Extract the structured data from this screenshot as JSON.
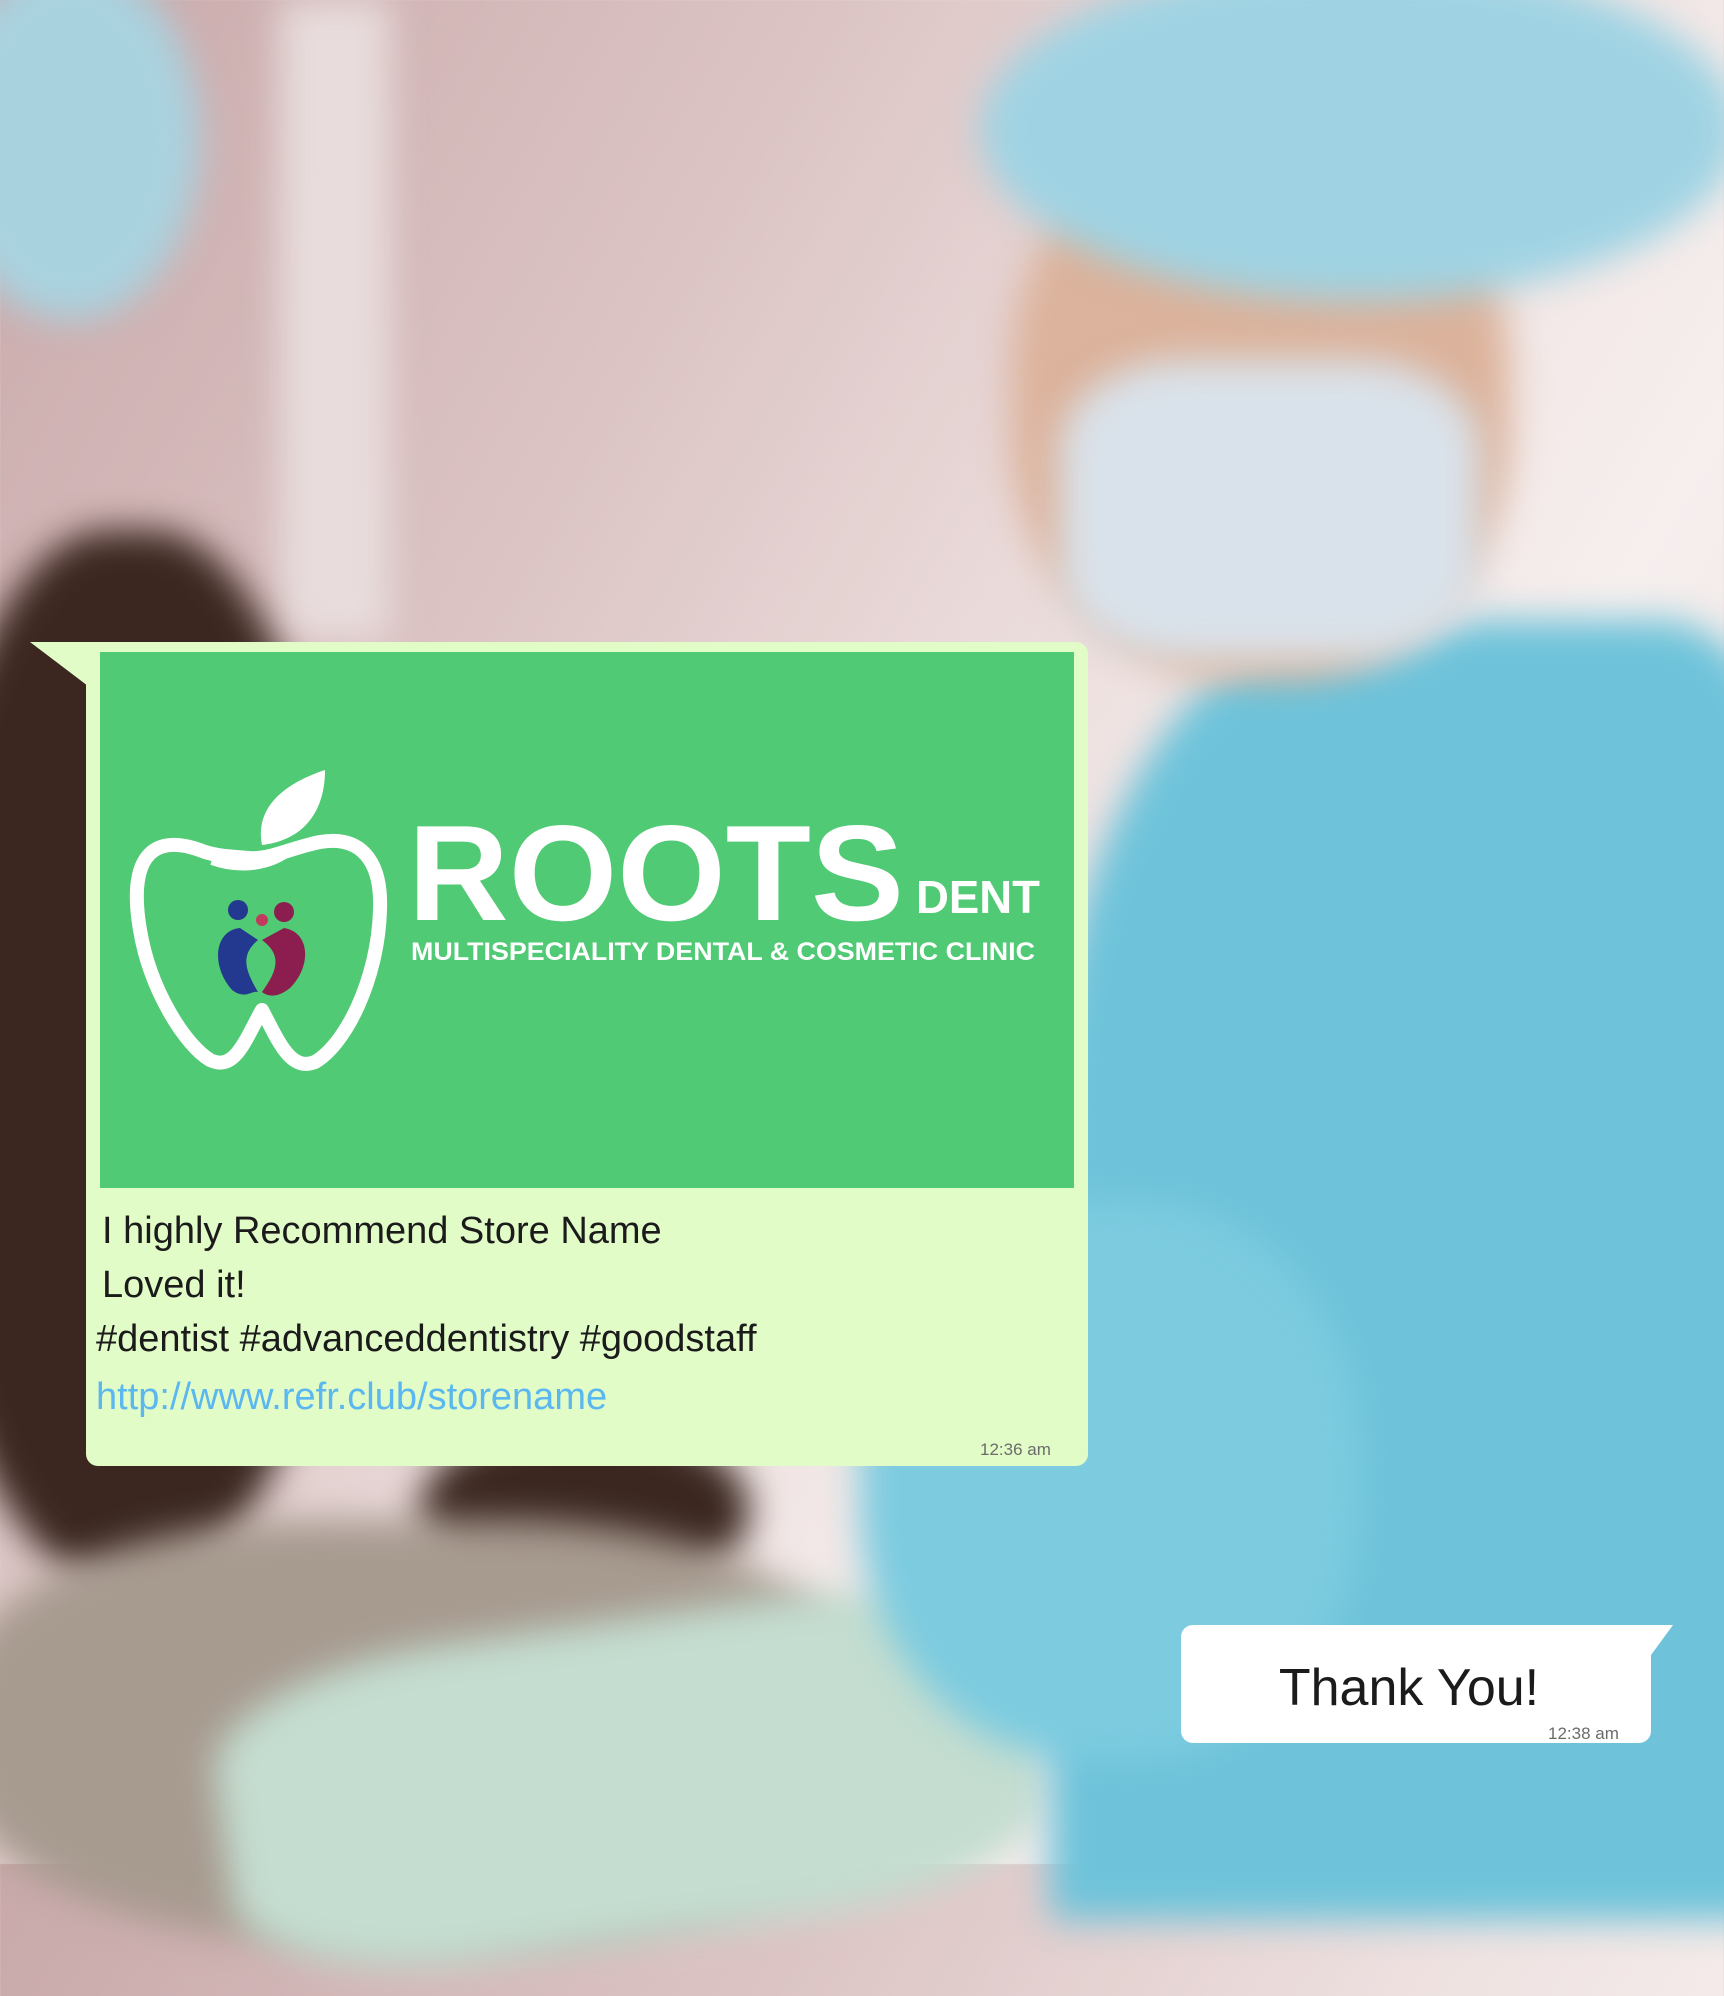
{
  "logo": {
    "brand": "ROOTS",
    "suffix": "DENT",
    "tagline": "MULTISPECIALITY DENTAL & COSMETIC CLINIC"
  },
  "incoming_message": {
    "lines": [
      "I highly Recommend Store Name",
      "Loved it!",
      "#dentist #advanceddentistry #goodstaff"
    ],
    "link": "http://www.refr.club/storename",
    "time": "12:36 am"
  },
  "outgoing_message": {
    "text": "Thank You!",
    "time": "12:38 am"
  },
  "colors": {
    "incoming_bubble": "#e2fcc8",
    "logo_background": "#50ca74",
    "link": "#5ab7ef",
    "outgoing_bubble": "#ffffff"
  }
}
